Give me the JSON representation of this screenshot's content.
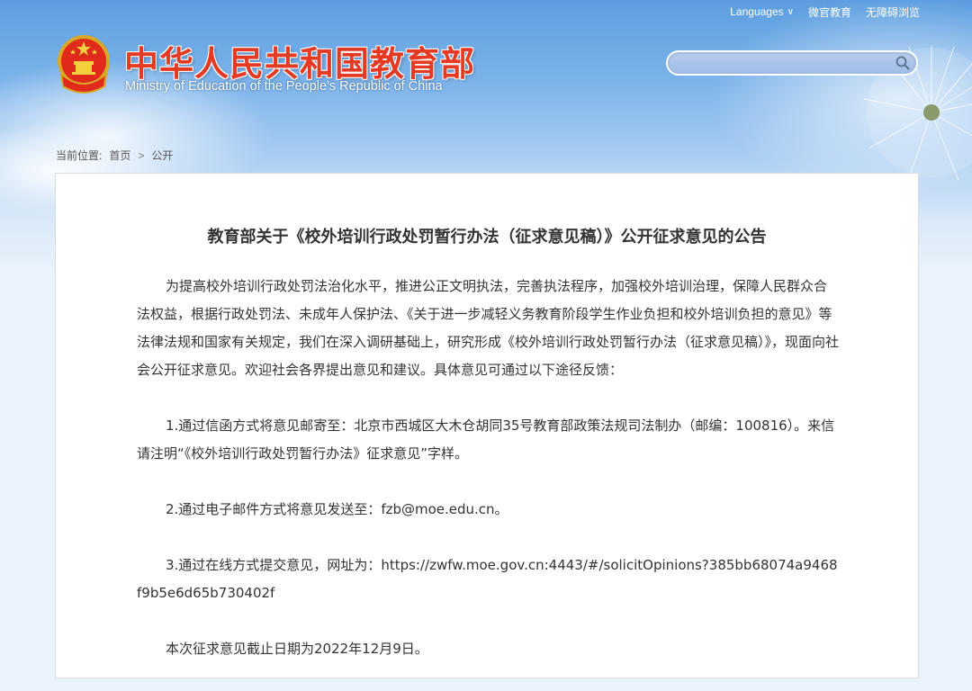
{
  "topnav": {
    "languages": "Languages",
    "wechat": "微官教育",
    "accessibility": "无障碍浏览"
  },
  "header": {
    "title_zh": "中华人民共和国教育部",
    "title_en": "Ministry of Education of the People's Republic of China"
  },
  "search": {
    "value": "",
    "placeholder": ""
  },
  "breadcrumb": {
    "prefix": "当前位置:",
    "home": "首页",
    "separator": ">",
    "current": "公开"
  },
  "article": {
    "title": "教育部关于《校外培训行政处罚暂行办法（征求意见稿）》公开征求意见的公告",
    "paragraphs": [
      "为提高校外培训行政处罚法治化水平，推进公正文明执法，完善执法程序，加强校外培训治理，保障人民群众合法权益，根据行政处罚法、未成年人保护法、《关于进一步减轻义务教育阶段学生作业负担和校外培训负担的意见》等法律法规和国家有关规定，我们在深入调研基础上，研究形成《校外培训行政处罚暂行办法（征求意见稿）》，现面向社会公开征求意见。欢迎社会各界提出意见和建议。具体意见可通过以下途径反馈：",
      "1.通过信函方式将意见邮寄至：北京市西城区大木仓胡同35号教育部政策法规司法制办（邮编：100816）。来信请注明“《校外培训行政处罚暂行办法》征求意见”字样。",
      "2.通过电子邮件方式将意见发送至：fzb@moe.edu.cn。",
      "3.通过在线方式提交意见，网址为：https://zwfw.moe.gov.cn:4443/#/solicitOpinions?385bb68074a9468f9b5e6d65b730402f",
      "本次征求意见截止日期为2022年12月9日。"
    ]
  },
  "colors": {
    "brand_red": "#e43a24",
    "sky_blue": "#6aa8e6",
    "text": "#333333"
  },
  "icons": [
    "chevron-down-icon",
    "search-icon",
    "national-emblem-icon"
  ]
}
